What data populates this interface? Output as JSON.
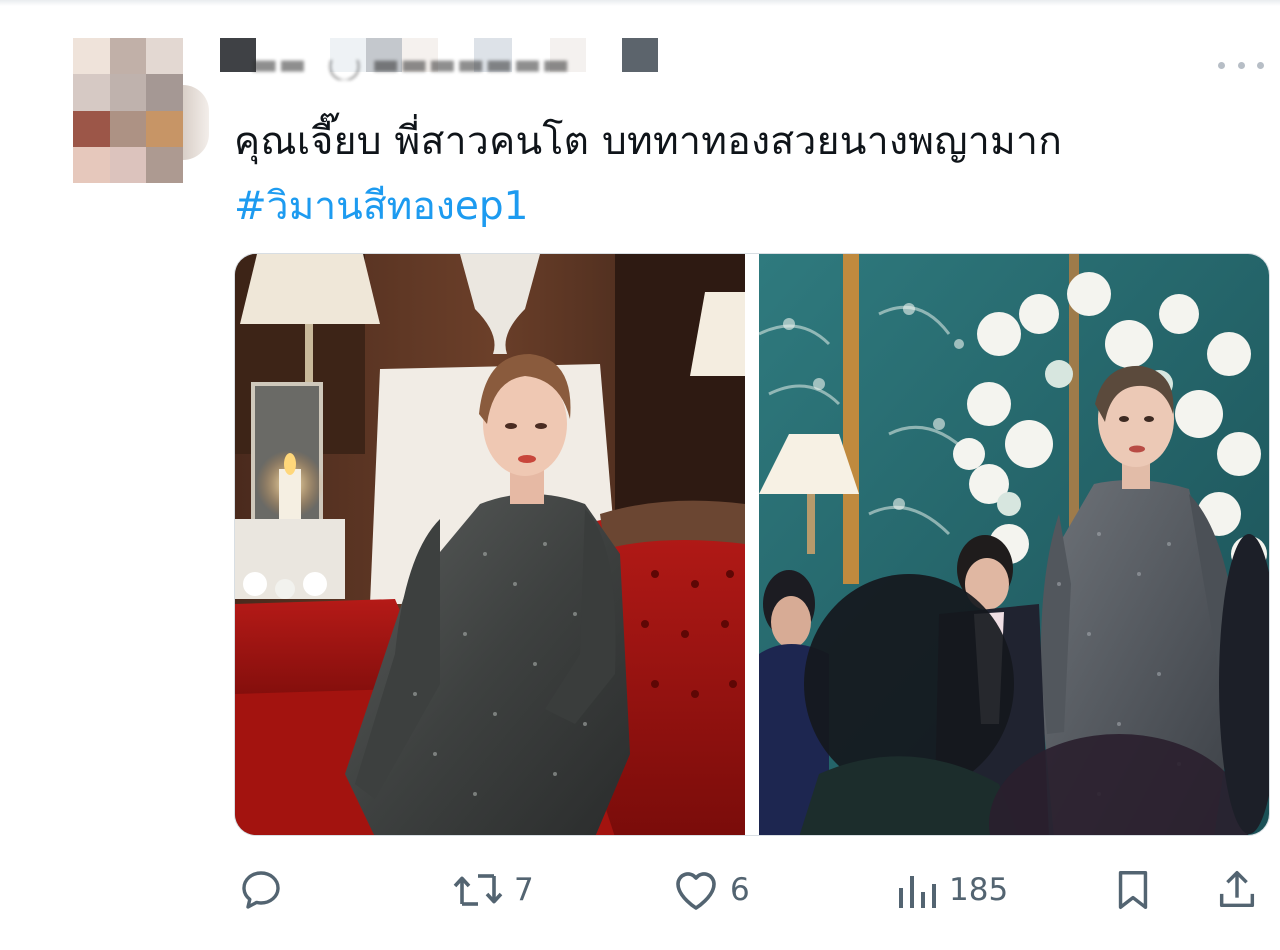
{
  "tweet": {
    "text": "คุณเจี๊ยบ พี่สาวคนโต บททาทองสวยนางพญามาก",
    "hashtag": "#วิมานสีทองep1",
    "media": [
      {
        "description_icon": "photo-left-woman-on-red-sofa"
      },
      {
        "description_icon": "photo-right-woman-standing-in-crowd"
      }
    ]
  },
  "actions": {
    "reply": {
      "icon": "reply-icon",
      "count": ""
    },
    "retweet": {
      "icon": "retweet-icon",
      "count": "7"
    },
    "like": {
      "icon": "heart-icon",
      "count": "6"
    },
    "views": {
      "icon": "views-icon",
      "count": "185"
    },
    "bookmark": {
      "icon": "bookmark-icon",
      "count": ""
    },
    "share": {
      "icon": "share-icon",
      "count": ""
    }
  },
  "colors": {
    "hashtag": "#1d9bf0",
    "text": "#0f1419",
    "icon": "#536471",
    "more_dots": "#b7bec6"
  }
}
